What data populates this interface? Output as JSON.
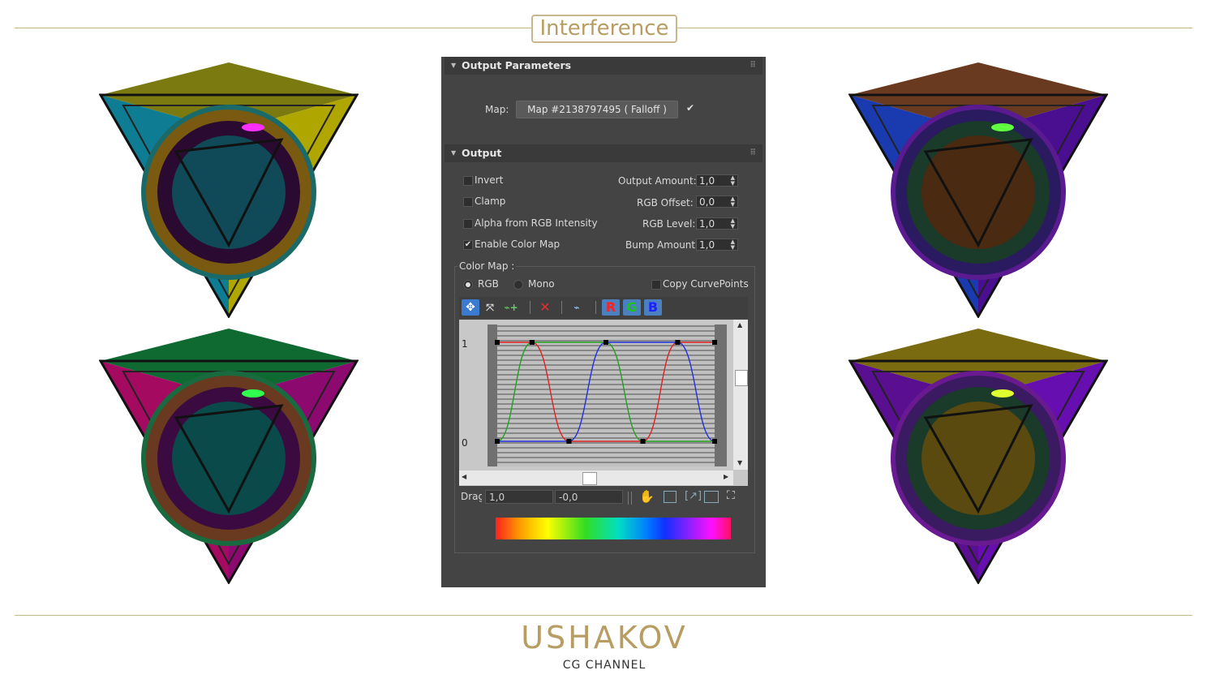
{
  "header": {
    "title": "Interference"
  },
  "brand": {
    "logo": "USHAKOV",
    "subtitle": "CG CHANNEL",
    "accent": "#b89d63"
  },
  "output_parameters": {
    "heading": "Output Parameters",
    "map_label": "Map:",
    "map_value": "Map #2138797495  ( Falloff )",
    "map_enabled_mark": "✔"
  },
  "output": {
    "heading": "Output",
    "invert": {
      "label": "Invert",
      "checked": false
    },
    "clamp": {
      "label": "Clamp",
      "checked": false
    },
    "alpha_rgb": {
      "label": "Alpha from RGB Intensity",
      "checked": false
    },
    "enable_color_map": {
      "label": "Enable Color Map",
      "checked": true,
      "mark": "✔"
    },
    "output_amount": {
      "label": "Output Amount:",
      "value": "1,0"
    },
    "rgb_offset": {
      "label": "RGB Offset:",
      "value": "0,0"
    },
    "rgb_level": {
      "label": "RGB Level:",
      "value": "1,0"
    },
    "bump_amount": {
      "label": "Bump Amount:",
      "value": "1,0"
    }
  },
  "color_map": {
    "label": "Color Map :",
    "rgb_label": "RGB",
    "mono_label": "Mono",
    "copy_label": "Copy CurvePoints",
    "channel_r": "R",
    "channel_g": "G",
    "channel_b": "B",
    "y_tick_top": "1",
    "y_tick_bottom": "0",
    "drag_label": "Drag",
    "drag_x": "1,0",
    "drag_y": "-0,0",
    "curves": {
      "red": [
        [
          0,
          1
        ],
        [
          0.16,
          1
        ],
        [
          0.33,
          0
        ],
        [
          0.67,
          0
        ],
        [
          0.83,
          1
        ],
        [
          1,
          1
        ]
      ],
      "green": [
        [
          0,
          0
        ],
        [
          0.16,
          1
        ],
        [
          0.5,
          1
        ],
        [
          0.67,
          0
        ],
        [
          1,
          0
        ]
      ],
      "blue": [
        [
          0,
          0
        ],
        [
          0.33,
          0
        ],
        [
          0.5,
          1
        ],
        [
          0.83,
          1
        ],
        [
          1,
          0
        ]
      ]
    }
  },
  "icons": [
    "move-icon",
    "scale-icon",
    "add-point-icon",
    "delete-icon",
    "reset-icon",
    "pan-hand-icon",
    "zoom-extents-icon",
    "zoom-h-icon",
    "zoom-v-icon",
    "zoom-region-icon"
  ],
  "cube_variants": [
    {
      "position": "top-left",
      "face_left": "#0a8aa0",
      "face_right": "#b8b000",
      "face_top": "#8a8a10",
      "accent": "#e020e0"
    },
    {
      "position": "bottom-left",
      "face_left": "#c01070",
      "face_right": "#b01080",
      "face_top": "#10a040",
      "accent": "#20e040"
    },
    {
      "position": "top-right",
      "face_left": "#2040d0",
      "face_right": "#5010a0",
      "face_top": "#a06010",
      "accent": "#40ff40"
    },
    {
      "position": "bottom-right",
      "face_left": "#6010a0",
      "face_right": "#7010c0",
      "face_top": "#b0a010",
      "accent": "#e0ff20"
    }
  ]
}
